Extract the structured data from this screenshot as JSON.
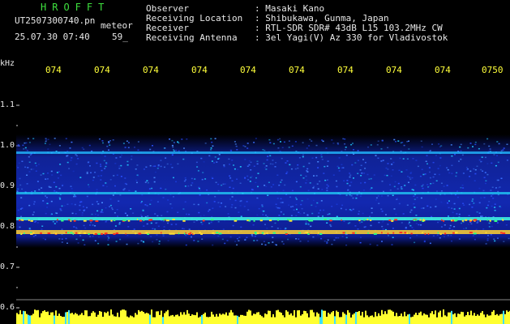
{
  "header": {
    "app_title": "HROFFT",
    "file_name": "UT2507300740.pn",
    "mode_label": "meteor",
    "timestamp": "25.07.30 07:40",
    "counter": "59_"
  },
  "station_info": [
    {
      "label": "Observer",
      "value": ": Masaki Kano"
    },
    {
      "label": "Receiving Location",
      "value": ": Shibukawa, Gunma, Japan"
    },
    {
      "label": "Receiver",
      "value": ": RTL-SDR SDR# 43dB L15 103.2MHz CW"
    },
    {
      "label": "Receiving Antenna",
      "value": ": 3el Yagi(V) Az 330 for Vladivostok"
    }
  ],
  "axis": {
    "unit_label": "kHz",
    "freq_ticks": [
      "1.1",
      "1.0",
      "0.9",
      "0.8",
      "0.7",
      "0.6"
    ],
    "time_ticks": [
      "074",
      "074",
      "074",
      "074",
      "074",
      "074",
      "074",
      "074",
      "074",
      "0750"
    ]
  },
  "colors": {
    "background": "#000000",
    "header_green": "#3ee03e",
    "text_white": "#e8e8e8",
    "time_yellow": "#ffff3a",
    "band_blue": "#1c3cff",
    "band_cyan": "#22e0ff",
    "band_red": "#ff3020"
  }
}
